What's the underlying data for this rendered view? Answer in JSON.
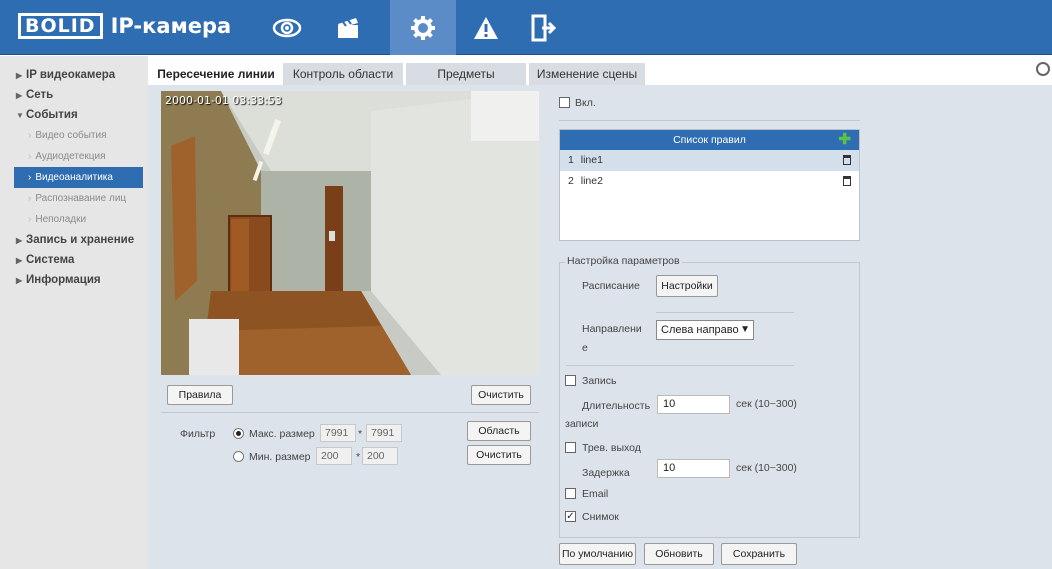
{
  "header": {
    "logo_brand": "BOLID",
    "logo_product": "IP-камера",
    "nav": [
      "live-view",
      "playback",
      "settings",
      "alarm",
      "logout"
    ]
  },
  "sidebar": {
    "items": [
      {
        "label": "IP видеокамера"
      },
      {
        "label": "Сеть"
      },
      {
        "label": "События"
      },
      {
        "label": "Запись и хранение"
      },
      {
        "label": "Система"
      },
      {
        "label": "Информация"
      }
    ],
    "events_sub": [
      "Видео события",
      "Аудиодетекция",
      "Видеоаналитика",
      "Распознавание лиц",
      "Неполадки"
    ]
  },
  "tabs": [
    "Пересечение линии",
    "Контроль области",
    "Предметы",
    "Изменение сцены"
  ],
  "video": {
    "timestamp": "2000-01-01 03:33:53"
  },
  "left_controls": {
    "rules_btn": "Правила",
    "clear_btn": "Очистить",
    "filter_label": "Фильтр",
    "max_size_label": "Макс. размер",
    "max_w": "7991",
    "max_h": "7991",
    "min_size_label": "Мин. размер",
    "min_w": "200",
    "min_h": "200",
    "times": "*",
    "area_btn": "Область",
    "clear_btn2": "Очистить"
  },
  "right": {
    "enable_label": "Вкл.",
    "rules_title": "Список правил",
    "rules": [
      {
        "num": "1",
        "name": "line1"
      },
      {
        "num": "2",
        "name": "line2"
      }
    ],
    "params_legend": "Настройка параметров",
    "schedule_label": "Расписание",
    "settings_btn": "Настройки",
    "direction_label_1": "Направлени",
    "direction_label_2": "е",
    "direction_value": "Слева направо",
    "record_label": "Запись",
    "record_duration_1": "Длительность",
    "record_duration_2": "записи",
    "record_duration_value": "10",
    "sec_range": "сек (10~300)",
    "alarm_out_label": "Трев. выход",
    "delay_label": "Задержка",
    "delay_value": "10",
    "email_label": "Email",
    "snapshot_label": "Снимок",
    "default_btn": "По умолчанию",
    "refresh_btn": "Обновить",
    "save_btn": "Сохранить"
  }
}
